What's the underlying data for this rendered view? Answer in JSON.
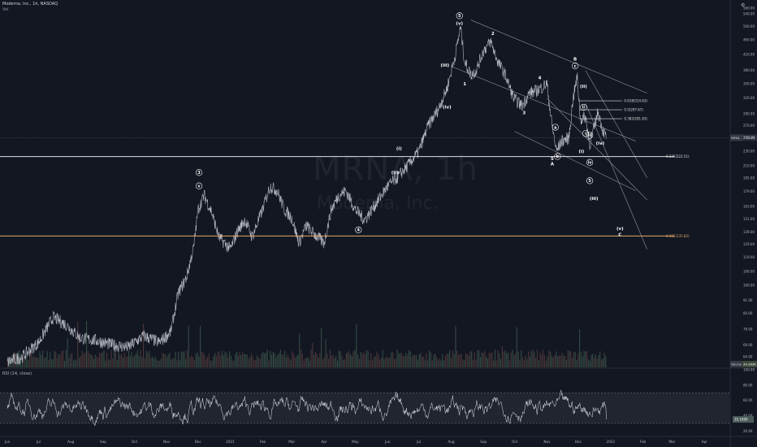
{
  "header": {
    "title": "Moderna, Inc., 1h, NASDAQ",
    "subtitle": "Vol"
  },
  "watermark": {
    "symbol": "MRNA, 1h",
    "name": "Moderna, Inc."
  },
  "rsi_label": "RSI (14, close)",
  "colors": {
    "background": "#131722",
    "price_line": "#d1d4dc",
    "volume": "#4a4f3a",
    "fib_line": "#e0e0e0",
    "fib_orange": "#e0a868",
    "wave_label": "#ffffff",
    "rsi_band": "#2a2e39"
  },
  "chart_data": [
    {
      "type": "line",
      "scale": "log",
      "ylim": [
        60,
        560
      ],
      "x_ticks": [
        "Jun",
        "Jul",
        "Aug",
        "Sep",
        "Oct",
        "Nov",
        "Dec",
        "2021",
        "Feb",
        "Mar",
        "Apr",
        "May",
        "Jun",
        "Jul",
        "Aug",
        "Sep",
        "Oct",
        "Nov",
        "Dec",
        "2022",
        "Feb",
        "Mar",
        "Apr"
      ],
      "y_ticks": [
        "560.00",
        "540.00",
        "500.00",
        "460.00",
        "420.00",
        "380.00",
        "350.00",
        "320.00",
        "290.00",
        "270.00",
        "250.00",
        "230.00",
        "210.00",
        "195.00",
        "179.00",
        "163.00",
        "151.00",
        "139.00",
        "129.00",
        "119.00",
        "109.00",
        "100.00",
        "91.00",
        "84.00",
        "76.00",
        "69.00",
        "64.00"
      ],
      "current_price_label": "250.21",
      "current_price_badge": "MRNA",
      "current_price": 250.21,
      "volume_badge": "Volume",
      "volume_value": "34.283K",
      "series": [
        {
          "points": [
            [
              "2020-06-01",
              62
            ],
            [
              "2020-06-15",
              64
            ],
            [
              "2020-07-01",
              70
            ],
            [
              "2020-07-15",
              82
            ],
            [
              "2020-07-28",
              78
            ],
            [
              "2020-08-10",
              72
            ],
            [
              "2020-08-25",
              71
            ],
            [
              "2020-09-10",
              69
            ],
            [
              "2020-09-25",
              68
            ],
            [
              "2020-10-10",
              73
            ],
            [
              "2020-10-25",
              70
            ],
            [
              "2020-11-05",
              75
            ],
            [
              "2020-11-12",
              95
            ],
            [
              "2020-11-20",
              105
            ],
            [
              "2020-11-27",
              127
            ],
            [
              "2020-12-01",
              160
            ],
            [
              "2020-12-07",
              175
            ],
            [
              "2020-12-14",
              158
            ],
            [
              "2020-12-21",
              135
            ],
            [
              "2021-01-01",
              125
            ],
            [
              "2021-01-08",
              140
            ],
            [
              "2021-01-15",
              150
            ],
            [
              "2021-01-22",
              135
            ],
            [
              "2021-02-01",
              160
            ],
            [
              "2021-02-08",
              185
            ],
            [
              "2021-02-15",
              180
            ],
            [
              "2021-02-22",
              160
            ],
            [
              "2021-03-01",
              152
            ],
            [
              "2021-03-08",
              130
            ],
            [
              "2021-03-15",
              145
            ],
            [
              "2021-03-22",
              138
            ],
            [
              "2021-04-01",
              130
            ],
            [
              "2021-04-08",
              160
            ],
            [
              "2021-04-15",
              175
            ],
            [
              "2021-04-22",
              180
            ],
            [
              "2021-05-01",
              160
            ],
            [
              "2021-05-10",
              150
            ],
            [
              "2021-05-20",
              165
            ],
            [
              "2021-06-01",
              185
            ],
            [
              "2021-06-10",
              195
            ],
            [
              "2021-06-20",
              210
            ],
            [
              "2021-07-01",
              230
            ],
            [
              "2021-07-10",
              270
            ],
            [
              "2021-07-20",
              300
            ],
            [
              "2021-07-28",
              340
            ],
            [
              "2021-08-05",
              420
            ],
            [
              "2021-08-10",
              497
            ],
            [
              "2021-08-14",
              400
            ],
            [
              "2021-08-20",
              370
            ],
            [
              "2021-08-25",
              380
            ],
            [
              "2021-09-01",
              430
            ],
            [
              "2021-09-08",
              455
            ],
            [
              "2021-09-15",
              400
            ],
            [
              "2021-09-22",
              370
            ],
            [
              "2021-09-30",
              320
            ],
            [
              "2021-10-08",
              305
            ],
            [
              "2021-10-15",
              330
            ],
            [
              "2021-10-22",
              335
            ],
            [
              "2021-11-01",
              350
            ],
            [
              "2021-11-05",
              280
            ],
            [
              "2021-11-10",
              230
            ],
            [
              "2021-11-15",
              245
            ],
            [
              "2021-11-22",
              250
            ],
            [
              "2021-11-26",
              320
            ],
            [
              "2021-11-30",
              365
            ],
            [
              "2021-12-03",
              280
            ],
            [
              "2021-12-08",
              285
            ],
            [
              "2021-12-12",
              240
            ],
            [
              "2021-12-16",
              265
            ],
            [
              "2021-12-20",
              295
            ],
            [
              "2021-12-24",
              265
            ],
            [
              "2021-12-28",
              250.21
            ]
          ]
        }
      ],
      "horizontal_levels": [
        {
          "label": "0.236(222.51)",
          "value": 222.51
        },
        {
          "label": "0.382(135.82)",
          "value": 135.82
        }
      ],
      "fib_levels": [
        {
          "label": "0.618(314.63)",
          "value": 314.63
        },
        {
          "label": "0.5(297.67)",
          "value": 297.67
        },
        {
          "label": "0.382(281.63)",
          "value": 281.63
        }
      ],
      "wave_labels": [
        {
          "text": "5",
          "date": "2021-08-09",
          "value": 530,
          "circled": true
        },
        {
          "text": "(v)",
          "date": "2021-08-09",
          "value": 505
        },
        {
          "text": "(iii)",
          "date": "2021-07-26",
          "value": 390
        },
        {
          "text": "(iv)",
          "date": "2021-07-28",
          "value": 300
        },
        {
          "text": "(i)",
          "date": "2021-06-12",
          "value": 232
        },
        {
          "text": "(ii)",
          "date": "2021-06-08",
          "value": 200
        },
        {
          "text": "3",
          "date": "2020-12-02",
          "value": 200,
          "circled": true
        },
        {
          "text": "v",
          "date": "2020-12-02",
          "value": 184,
          "circled": true
        },
        {
          "text": "4",
          "date": "2021-05-04",
          "value": 140,
          "circled": true
        },
        {
          "text": "1",
          "date": "2021-08-14",
          "value": 347
        },
        {
          "text": "2",
          "date": "2021-09-10",
          "value": 475
        },
        {
          "text": "3",
          "date": "2021-10-10",
          "value": 290
        },
        {
          "text": "4",
          "date": "2021-10-25",
          "value": 360
        },
        {
          "text": "5",
          "date": "2021-11-06",
          "value": 218
        },
        {
          "text": "A",
          "date": "2021-11-06",
          "value": 211
        },
        {
          "text": "a",
          "date": "2021-11-09",
          "value": 265,
          "circled": true
        },
        {
          "text": "b",
          "date": "2021-11-11",
          "value": 221,
          "circled": true
        },
        {
          "text": "B",
          "date": "2021-11-28",
          "value": 405
        },
        {
          "text": "c",
          "date": "2021-11-28",
          "value": 388,
          "circled": true
        },
        {
          "text": "(ii)",
          "date": "2021-12-06",
          "value": 342
        },
        {
          "text": "ii",
          "date": "2021-12-06",
          "value": 300,
          "circled": true
        },
        {
          "text": "i",
          "date": "2021-12-08",
          "value": 255,
          "circled": true
        },
        {
          "text": "iii",
          "date": "2021-12-12",
          "value": 252,
          "circled": true
        },
        {
          "text": "(iv)",
          "date": "2021-12-22",
          "value": 240
        },
        {
          "text": "(i)",
          "date": "2021-12-04",
          "value": 228
        },
        {
          "text": "iv",
          "date": "2021-12-12",
          "value": 213,
          "circled": true
        },
        {
          "text": "5",
          "date": "2021-12-12",
          "value": 190,
          "circled": true
        },
        {
          "text": "(iii)",
          "date": "2021-12-16",
          "value": 170
        },
        {
          "text": "(v)",
          "date": "2022-01-10",
          "value": 141
        },
        {
          "text": "C",
          "date": "2022-01-10",
          "value": 136
        }
      ],
      "channels": [
        {
          "from": [
            "2021-08-20",
            520
          ],
          "to": [
            "2022-02-05",
            330
          ]
        },
        {
          "from": [
            "2021-08-01",
            390
          ],
          "to": [
            "2022-01-25",
            245
          ]
        },
        {
          "from": [
            "2021-10-01",
            260
          ],
          "to": [
            "2022-01-25",
            180
          ]
        },
        {
          "from": [
            "2021-11-01",
            320
          ],
          "to": [
            "2022-02-05",
            170
          ]
        },
        {
          "from": [
            "2021-12-08",
            380
          ],
          "to": [
            "2022-02-05",
            195
          ]
        },
        {
          "from": [
            "2021-12-08",
            310
          ],
          "to": [
            "2022-02-05",
            125
          ]
        }
      ]
    },
    {
      "type": "line",
      "ylim": [
        15,
        100
      ],
      "y_ticks": [
        "100.00",
        "80.00",
        "60.00",
        "40.00",
        "20.00"
      ],
      "band": [
        30,
        70
      ],
      "current_value_label": "35.1000",
      "current_value": 35.1
    }
  ]
}
